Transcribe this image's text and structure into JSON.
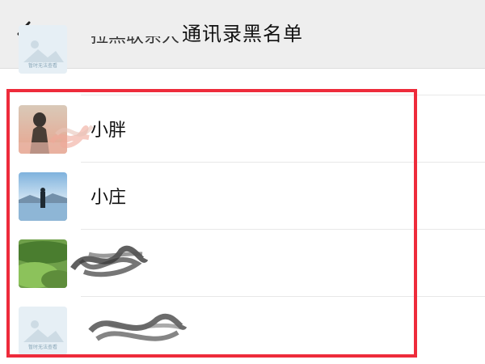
{
  "header": {
    "title": "通讯录黑名单",
    "back_icon": "chevron-left-icon"
  },
  "placeholder_caption": "暂时无法查看",
  "contacts": [
    {
      "name": "",
      "avatar": "placeholder",
      "partial_name": "拉黑联系人"
    },
    {
      "name": "小胖",
      "avatar": "photo-silhouette-warm"
    },
    {
      "name": "小庄",
      "avatar": "photo-person-by-lake"
    },
    {
      "name": "",
      "avatar": "photo-green-hills"
    },
    {
      "name": "",
      "avatar": "placeholder"
    }
  ],
  "colors": {
    "header_bg": "#eeeeee",
    "highlight_border": "#ee2b3b",
    "divider": "#e8e8e8"
  }
}
